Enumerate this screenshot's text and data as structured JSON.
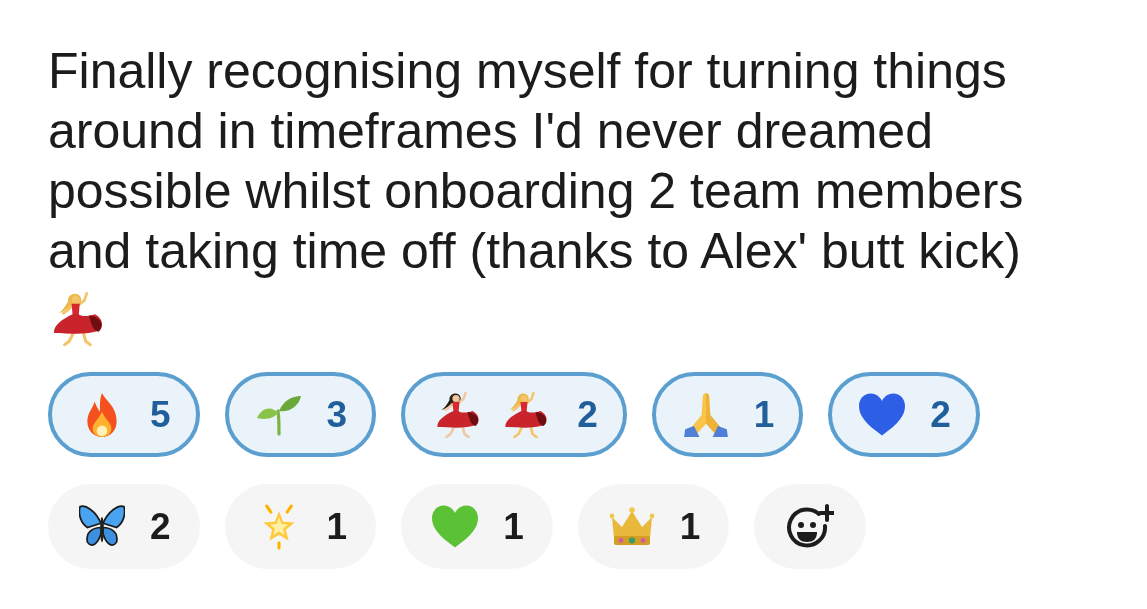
{
  "message": {
    "text": "Finally recognising myself for turning things around in timeframes I'd never dreamed possible whilst onboarding 2 team members and taking time off (thanks to Alex' butt kick)"
  },
  "reactions": [
    {
      "kind": "fire",
      "count": "5",
      "selected": true
    },
    {
      "kind": "sprout",
      "count": "3",
      "selected": true
    },
    {
      "kind": "dancers",
      "count": "2",
      "selected": true
    },
    {
      "kind": "pray",
      "count": "1",
      "selected": true
    },
    {
      "kind": "heart",
      "color": "#2c5fe6",
      "count": "2",
      "selected": true
    },
    {
      "kind": "butterfly",
      "count": "2",
      "selected": false
    },
    {
      "kind": "star",
      "count": "1",
      "selected": false
    },
    {
      "kind": "heart",
      "color": "#5bc236",
      "count": "1",
      "selected": false
    },
    {
      "kind": "crown",
      "count": "1",
      "selected": false
    }
  ]
}
